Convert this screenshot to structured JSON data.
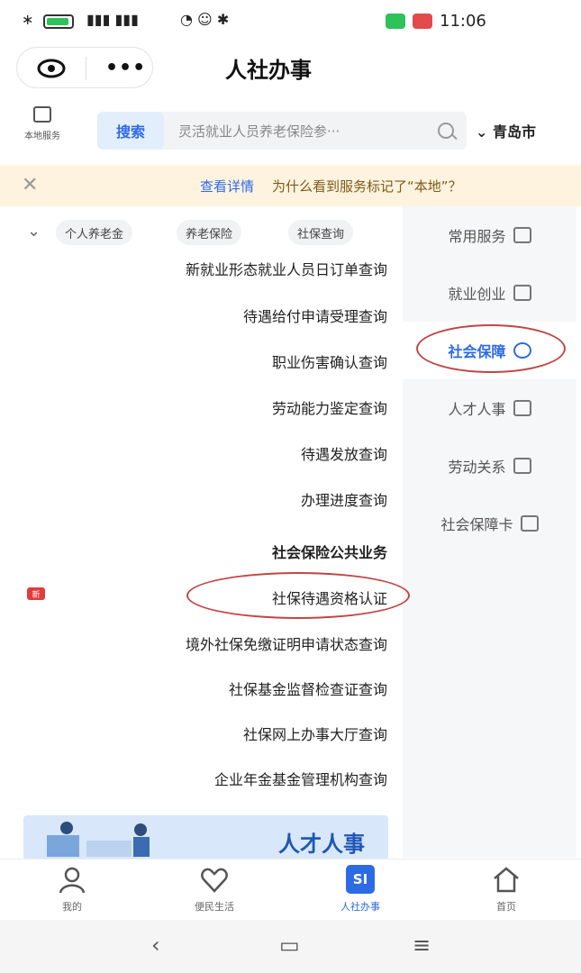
{
  "status_bar": {
    "time": "11:06",
    "left_icons": [
      "battery-icon",
      "signal-icon",
      "wifi-icon",
      "alarm-icon"
    ],
    "battery_color": "#2fc15a"
  },
  "header": {
    "title": "人社办事",
    "capsule": {
      "eye_icon": "eye-icon",
      "more_icon": "more-dots-icon",
      "more_label": "•••"
    }
  },
  "search": {
    "local_service_label": "本地服务",
    "button_label": "搜索",
    "placeholder": "灵活就业人员养老保险参···",
    "city": "青岛市",
    "city_chevron": "⌄"
  },
  "notice": {
    "text": "为什么看到服务标记了“本地”？",
    "link": "查看详情",
    "close": "✕"
  },
  "categories": [
    {
      "label": "常用服务",
      "icon": "grid-icon",
      "active": false
    },
    {
      "label": "就业创业",
      "icon": "briefcase-icon",
      "active": false
    },
    {
      "label": "社会保障",
      "icon": "shield-icon",
      "active": true
    },
    {
      "label": "人才人事",
      "icon": "person-icon",
      "active": false
    },
    {
      "label": "劳动关系",
      "icon": "contract-icon",
      "active": false
    },
    {
      "label": "社会保障卡",
      "icon": "card-icon",
      "active": false
    }
  ],
  "tags": {
    "chevron": "⌄",
    "items": [
      "个人养老金",
      "养老保险",
      "社保查询",
      "社保查询"
    ]
  },
  "list": {
    "items": [
      {
        "label": "新就业形态就业人员日订单查询",
        "heading": false
      },
      {
        "label": "待遇给付申请受理查询",
        "heading": false
      },
      {
        "label": "职业伤害确认查询",
        "heading": false
      },
      {
        "label": "劳动能力鉴定查询",
        "heading": false
      },
      {
        "label": "待遇发放查询",
        "heading": false
      },
      {
        "label": "办理进度查询",
        "heading": false
      },
      {
        "label": "社会保险公共业务",
        "heading": true
      },
      {
        "label": "社保待遇资格认证",
        "heading": false
      },
      {
        "label": "境外社保免缴证明申请状态查询",
        "heading": false
      },
      {
        "label": "社保基金监督检查证查询",
        "heading": false
      },
      {
        "label": "社保网上办事大厅查询",
        "heading": false
      },
      {
        "label": "企业年金基金管理机构查询",
        "heading": false
      }
    ],
    "new_badge": "新"
  },
  "banner": {
    "title": "人才人事"
  },
  "bottom_nav": [
    {
      "label": "首页",
      "icon": "home-icon",
      "active": false
    },
    {
      "label": "人社办事",
      "icon": "si-icon",
      "icon_text": "SI",
      "active": true
    },
    {
      "label": "便民生活",
      "icon": "heart-icon",
      "active": false
    },
    {
      "label": "我的",
      "icon": "user-icon",
      "active": false
    }
  ],
  "system_nav": {
    "menu": "≡",
    "home": "▭",
    "back": "‹"
  },
  "colors": {
    "accent": "#2d6be5",
    "highlight": "#c24545",
    "notice_bg": "#fdf3df"
  }
}
